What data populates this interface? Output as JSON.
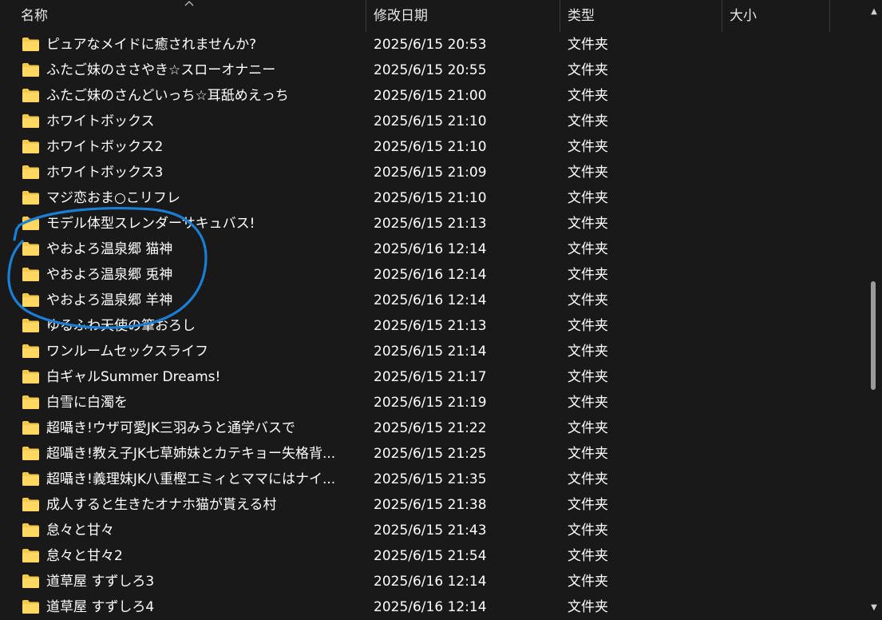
{
  "columns": {
    "name": "名称",
    "date": "修改日期",
    "type": "类型",
    "size": "大小"
  },
  "rows": [
    {
      "name": "ピュアなメイドに癒されませんか?",
      "date": "2025/6/15 20:53",
      "type": "文件夹"
    },
    {
      "name": "ふたご妹のささやき☆スローオナニー",
      "date": "2025/6/15 20:55",
      "type": "文件夹"
    },
    {
      "name": "ふたご妹のさんどいっち☆耳舐めえっち",
      "date": "2025/6/15 21:00",
      "type": "文件夹"
    },
    {
      "name": "ホワイトボックス",
      "date": "2025/6/15 21:10",
      "type": "文件夹"
    },
    {
      "name": "ホワイトボックス2",
      "date": "2025/6/15 21:10",
      "type": "文件夹"
    },
    {
      "name": "ホワイトボックス3",
      "date": "2025/6/15 21:09",
      "type": "文件夹"
    },
    {
      "name": "マジ恋おま○こリフレ",
      "date": "2025/6/15 21:10",
      "type": "文件夹"
    },
    {
      "name": "モデル体型スレンダーサキュバス!",
      "date": "2025/6/15 21:13",
      "type": "文件夹"
    },
    {
      "name": "やおよろ温泉郷 猫神",
      "date": "2025/6/16 12:14",
      "type": "文件夹"
    },
    {
      "name": "やおよろ温泉郷 兎神",
      "date": "2025/6/16 12:14",
      "type": "文件夹"
    },
    {
      "name": "やおよろ温泉郷 羊神",
      "date": "2025/6/16 12:14",
      "type": "文件夹"
    },
    {
      "name": "ゆるふわ天使の筆おろし",
      "date": "2025/6/15 21:13",
      "type": "文件夹"
    },
    {
      "name": "ワンルームセックスライフ",
      "date": "2025/6/15 21:14",
      "type": "文件夹"
    },
    {
      "name": "白ギャルSummer Dreams!",
      "date": "2025/6/15 21:17",
      "type": "文件夹"
    },
    {
      "name": "白雪に白濁を",
      "date": "2025/6/15 21:19",
      "type": "文件夹"
    },
    {
      "name": "超囁き!ウザ可愛JK三羽みうと通学バスで",
      "date": "2025/6/15 21:22",
      "type": "文件夹"
    },
    {
      "name": "超囁き!教え子JK七草姉妹とカテキョー失格背...",
      "date": "2025/6/15 21:25",
      "type": "文件夹"
    },
    {
      "name": "超囁き!義理妹JK八重樫エミィとママにはナイ...",
      "date": "2025/6/15 21:35",
      "type": "文件夹"
    },
    {
      "name": "成人すると生きたオナホ猫が貰える村",
      "date": "2025/6/15 21:38",
      "type": "文件夹"
    },
    {
      "name": "怠々と甘々",
      "date": "2025/6/15 21:43",
      "type": "文件夹"
    },
    {
      "name": "怠々と甘々2",
      "date": "2025/6/15 21:54",
      "type": "文件夹"
    },
    {
      "name": "道草屋 すずしろ3",
      "date": "2025/6/16 12:14",
      "type": "文件夹"
    },
    {
      "name": "道草屋 すずしろ4",
      "date": "2025/6/16 12:14",
      "type": "文件夹"
    }
  ],
  "colors": {
    "background": "#191919",
    "folder": "#f7c948",
    "annotation": "#1a7fd4"
  },
  "icons": {
    "folder": "folder-icon",
    "sort": "sort-ascending-icon"
  }
}
